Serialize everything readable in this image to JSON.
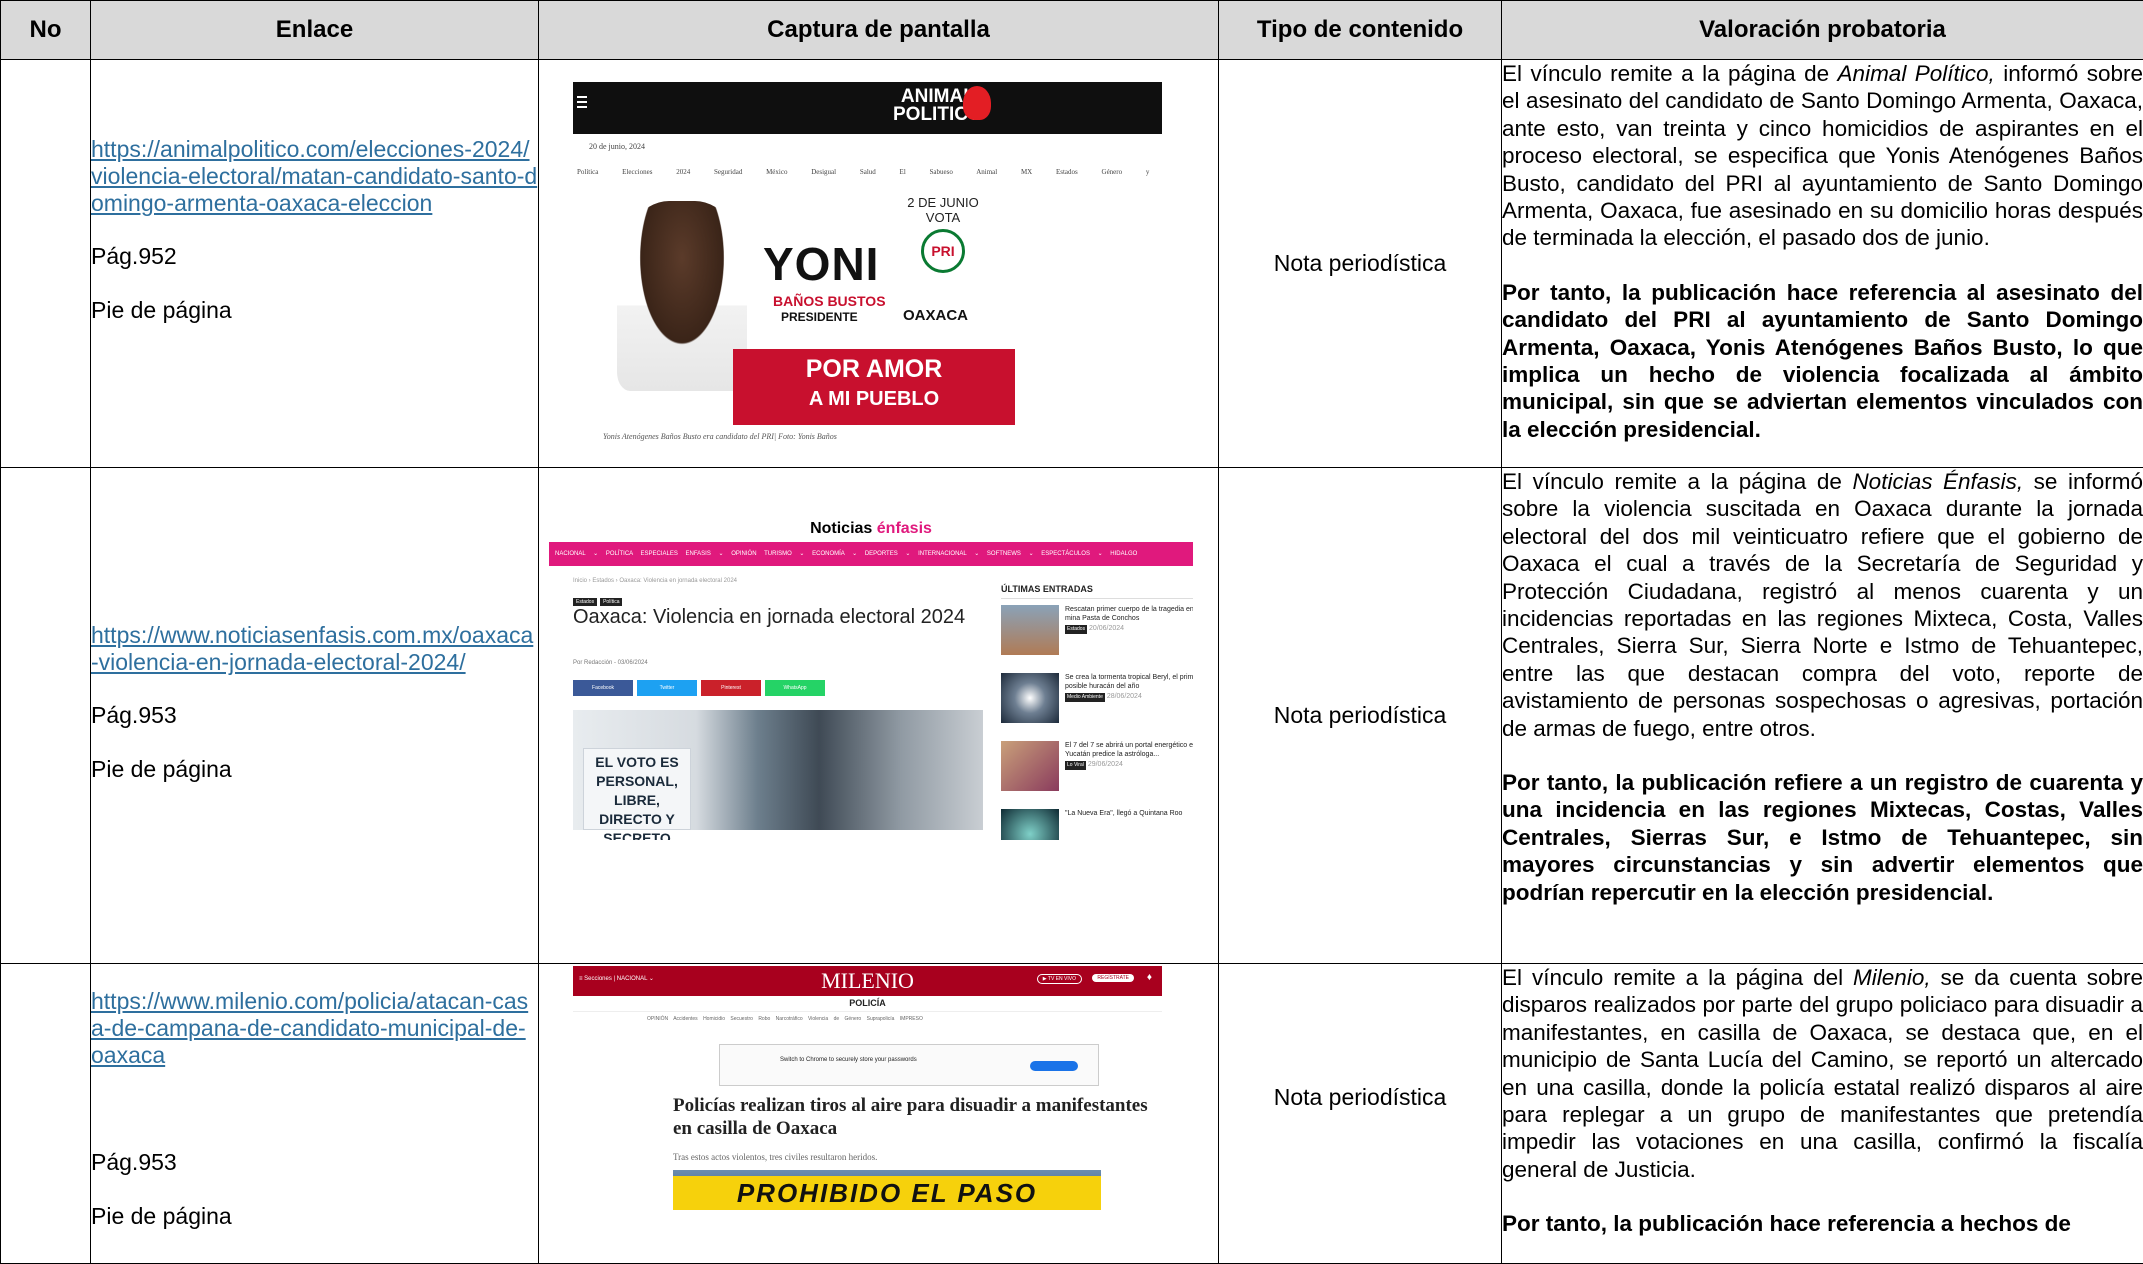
{
  "headers": {
    "no": "No",
    "enlace": "Enlace",
    "captura": "Captura de pantalla",
    "tipo": "Tipo de contenido",
    "valoracion": "Valoración probatoria"
  },
  "rows": [
    {
      "no": "",
      "link": "https://animalpolitico.com/elecciones-2024/violencia-electoral/matan-candidato-santo-domingo-armenta-oaxaca-eleccion",
      "pag": "Pág.952",
      "pie": "Pie de página",
      "tipo": "Nota periodística",
      "val_prefix": "El vínculo remite a la página de ",
      "val_source": "Animal Político,",
      "val_rest": " informó sobre el asesinato del candidato de Santo Domingo Armenta, Oaxaca, ante esto, van treinta y cinco homicidios de aspirantes en el proceso electoral, se especifica que Yonis Atenógenes Baños Busto, candidato del PRI al ayuntamiento de Santo Domingo Armenta, Oaxaca, fue asesinado en su domicilio horas después de terminada la elección, el pasado dos de junio.",
      "val_bold": "Por tanto, la publicación hace referencia al asesinato del candidato del PRI al ayuntamiento de Santo Domingo Armenta, Oaxaca, Yonis Atenógenes Baños Busto, lo que implica un hecho de violencia focalizada al ámbito municipal, sin que se adviertan elementos vinculados con la elección presidencial.",
      "shot": {
        "logo_line1": "ANIMAL",
        "logo_line2": "POLITICO",
        "date": "20 de junio, 2024",
        "nav": "Política Elecciones 2024 Seguridad México Desigual Salud El Sabueso Animal MX Estados Género y diversidad Inter",
        "vota": "2 DE JUNIO VOTA",
        "name": "YONI",
        "surname": "BAÑOS BUSTOS",
        "role": "PRESIDENTE",
        "pri": "PRI",
        "oaxaca": "OAXACA",
        "slogan1": "POR AMOR",
        "slogan2": "A MI PUEBLO",
        "caption": "Yonis Atenógenes Baños Busto era candidato del PRI| Foto: Yonis Baños"
      }
    },
    {
      "no": "",
      "link": "https://www.noticiasenfasis.com.mx/oaxaca-violencia-en-jornada-electoral-2024/",
      "pag": "Pág.953",
      "pie": "Pie de página",
      "tipo": "Nota periodística",
      "val_prefix": "El vínculo remite a la página de ",
      "val_source": "Noticias Énfasis,",
      "val_rest": " se informó sobre la violencia suscitada en Oaxaca durante la jornada electoral del dos mil veinticuatro refiere que el gobierno de Oaxaca el cual a través de la Secretaría de Seguridad y Protección Ciudadana, registró al menos cuarenta y un incidencias reportadas en las regiones Mixteca, Costa, Valles Centrales, Sierra Sur, Sierra Norte e Istmo de Tehuantepec, entre las que destacan compra del voto, reporte de avistamiento de personas sospechosas o agresivas, portación de armas de fuego, entre otros.",
      "val_bold": "Por tanto, la publicación refiere a un registro de cuarenta y una incidencia en las regiones Mixtecas, Costas, Valles Centrales, Sierras Sur, e Istmo de Tehuantepec, sin mayores circunstancias y sin advertir elementos que podrían repercutir en la elección presidencial.",
      "shot": {
        "brand1": "Noticias ",
        "brand2": "énfasis",
        "nav": "NACIONAL ⌄ POLÍTICA ESPECIALES ENFASIS ⌄ OPINIÓN TURISMO ⌄ ECONOMÍA ⌄ DEPORTES ⌄ INTERNACIONAL ⌄ SOFTNEWS ⌄ ESPECTÁCULOS ⌄ HIDALGO",
        "crumb": "Inicio › Estados › Oaxaca: Violencia en jornada electoral 2024",
        "tag1": "Estados",
        "tag2": "Política",
        "title": "Oaxaca: Violencia en jornada electoral 2024",
        "by": "Por Redacción - 03/06/2024",
        "share": [
          "Facebook",
          "Twitter",
          "Pinterest",
          "WhatsApp"
        ],
        "box": "EL VOTO ES PERSONAL, LIBRE, DIRECTO Y SECRETO",
        "side_head": "ÚLTIMAS ENTRADAS",
        "side": [
          {
            "t": "Rescatan primer cuerpo de la tragedia en la mina Pasta de Conchos",
            "b": "Estados",
            "d": "20/06/2024"
          },
          {
            "t": "Se crea la tormenta tropical Beryl, el primer posible huracán del año",
            "b": "Medio Ambiente",
            "d": "28/06/2024"
          },
          {
            "t": "El 7 del 7 se abrirá un portal energético en Yucatán predice la astróloga...",
            "b": "Lo Viral",
            "d": "29/06/2024"
          },
          {
            "t": "\"La Nueva Era\", llegó a Quintana Roo",
            "b": "",
            "d": ""
          }
        ]
      }
    },
    {
      "no": "",
      "link": "https://www.milenio.com/policia/atacan-casa-de-campana-de-candidato-municipal-de-oaxaca",
      "pag": "Pág.953",
      "pie": "Pie de página",
      "tipo": "Nota periodística",
      "val_prefix": "El vínculo remite a la página del ",
      "val_source": "Milenio,",
      "val_rest": " se da cuenta sobre disparos realizados por parte del grupo policiaco para disuadir a manifestantes, en casilla de Oaxaca, se destaca que, en el municipio de Santa Lucía del Camino, se reportó un altercado en una casilla, donde la policía estatal realizó disparos al aire para replegar a un grupo de manifestantes que pretendía impedir las votaciones en una casilla, confirmó la fiscalía general de Justicia.",
      "val_bold": "Por tanto, la publicación hace referencia a hechos de",
      "shot": {
        "logo": "MILENIO",
        "sections": "≡ Secciones | NACIONAL ⌄",
        "tv": "▶ TV EN VIVO",
        "reg": "REGÍSTRATE",
        "section": "POLICÍA",
        "sub": "OPINIÓN Accidentes Homicidio Secuestro Robo Narcotráfico Violencia de Género Suprapolicía IMPRESO",
        "ad": "Switch to Chrome to securely store your passwords",
        "headline": "Policías realizan tiros al aire para disuadir a manifestantes en casilla de Oaxaca",
        "dek": "Tras estos actos violentos, tres civiles resultaron heridos.",
        "tape": "PROHIBIDO EL PASO"
      }
    }
  ]
}
